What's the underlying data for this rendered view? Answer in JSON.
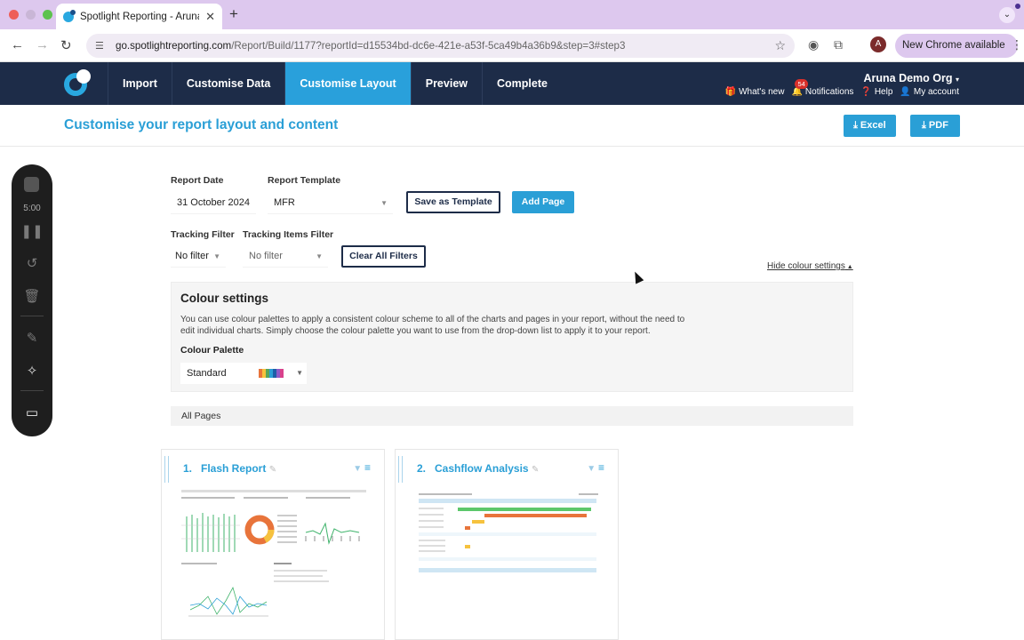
{
  "browser": {
    "tab_title": "Spotlight Reporting - Aruna D",
    "url_host": "go.spotlightreporting.com",
    "url_path": "/Report/Build/1177?reportId=d15534bd-dc6e-421e-a53f-5ca49b4a36b9&step=3#step3",
    "new_chrome": "New Chrome available",
    "profile_initial": "A"
  },
  "nav": {
    "tabs": [
      {
        "label": "Import"
      },
      {
        "label": "Customise Data"
      },
      {
        "label": "Customise Layout",
        "active": true
      },
      {
        "label": "Preview"
      },
      {
        "label": "Complete"
      }
    ],
    "org": "Aruna Demo Org",
    "whats_new": "What's new",
    "notifications": "Notifications",
    "notif_count": "54",
    "help": "Help",
    "account": "My account"
  },
  "page": {
    "title": "Customise your report layout and content",
    "excel": "Excel",
    "pdf": "PDF"
  },
  "recorder": {
    "time": "5:00"
  },
  "form": {
    "report_date_label": "Report Date",
    "report_date": "31 October 2024",
    "template_label": "Report Template",
    "template": "MFR",
    "save_template": "Save as Template",
    "add_page": "Add Page",
    "tracking_label": "Tracking Filter",
    "tracking": "No filter",
    "tracking_items_label": "Tracking Items Filter",
    "tracking_items": "No filter",
    "clear_filters": "Clear All Filters",
    "hide_colour": "Hide colour settings"
  },
  "colour": {
    "heading": "Colour settings",
    "description": "You can use colour palettes to apply a consistent colour scheme to all of the charts and pages in your report, without the need to edit individual charts. Simply choose the colour palette you want to use from the drop-down list to apply it to your report.",
    "palette_label": "Colour Palette",
    "palette": "Standard",
    "swatches": [
      "#e8743b",
      "#f6c23e",
      "#5aa55a",
      "#2a9fd6",
      "#1d5fa8",
      "#8e5bc7",
      "#d9418c"
    ]
  },
  "pages": {
    "section": "All Pages",
    "items": [
      {
        "num": "1.",
        "title": "Flash Report"
      },
      {
        "num": "2.",
        "title": "Cashflow Analysis"
      }
    ]
  }
}
